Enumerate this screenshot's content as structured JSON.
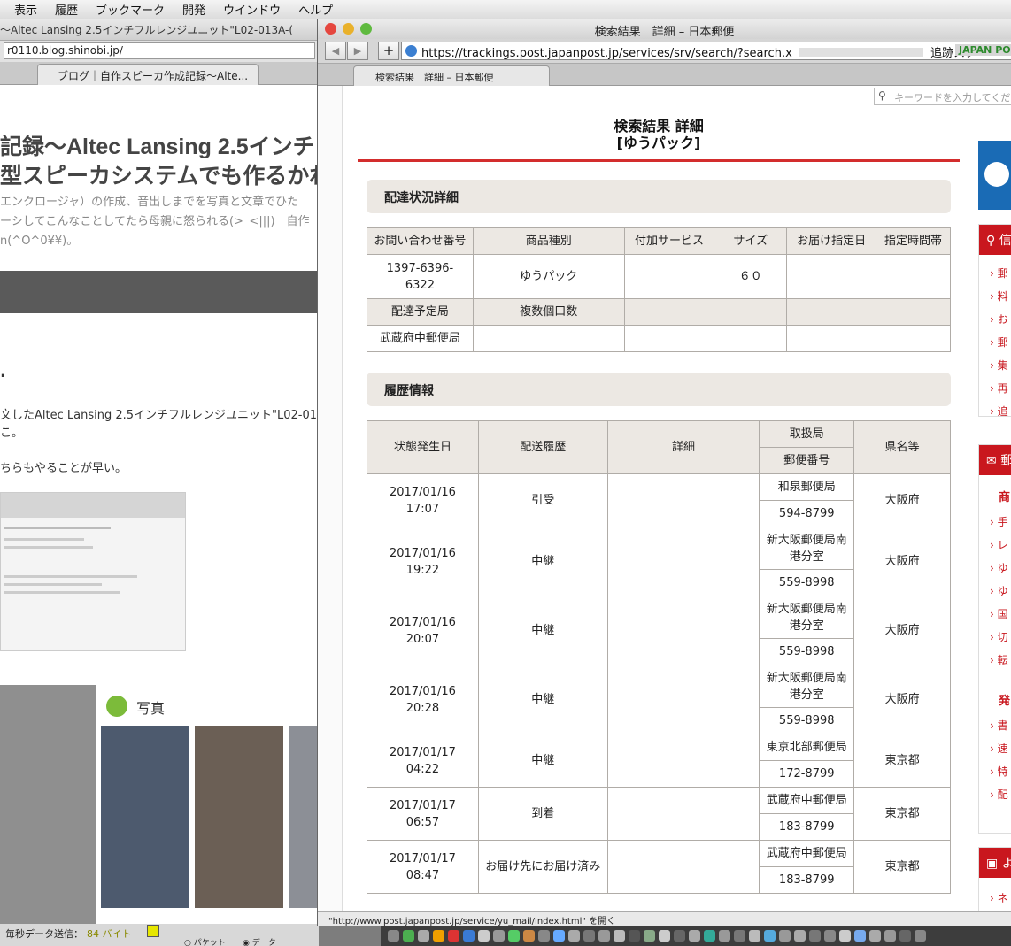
{
  "menubar": [
    "表示",
    "履歴",
    "ブックマーク",
    "開発",
    "ウインドウ",
    "ヘルプ"
  ],
  "bg_window": {
    "title": "〜Altec Lansing 2.5インチフルレンジユニット\"L02-013A-(",
    "url": "r0110.blog.shinobi.jp/",
    "tab": "ブログ｜自作スピーカ作成記録〜Alte...",
    "heading1": "記録〜Altec Lansing 2.5インチフ",
    "heading2": "型スピーカシステムでも作るかね",
    "sub1": "エンクロージャ）の作成、音出しまでを写真と文章でひた",
    "sub2": "ーシしてこんなことしてたら母親に怒られる(>_<|||)　自作",
    "sub3": "n(^O^0¥¥)。",
    "dot": ".",
    "body1": "文したAltec Lansing 2.5インチフルレンジユニット\"L02-01",
    "body2": "こ。",
    "body3": "ちらもやることが早い。",
    "photos_label": "写真",
    "status_label": "毎秒データ送信：",
    "status_value": "84 バイト",
    "radio1": "パケット",
    "radio2": "データ"
  },
  "main_window": {
    "title": "検索結果　詳細 – 日本郵便",
    "url": "https://trackings.post.japanpost.jp/services/srv/search/?search.x",
    "url_suffix": "追跡スター",
    "brand": "JAPAN POST",
    "tab": "検索結果　詳細 – 日本郵便",
    "search_placeholder": "キーワードを入力してくだ",
    "status_text": "\"http://www.post.japanpost.jp/service/yu_mail/index.html\" を開く"
  },
  "page": {
    "title_line1": "検索結果 詳細",
    "title_line2": "[ゆうパック]",
    "section1": "配達状況詳細",
    "section2": "履歴情報"
  },
  "status_table": {
    "headers": [
      "お問い合わせ番号",
      "商品種別",
      "付加サービス",
      "サイズ",
      "お届け指定日",
      "指定時間帯"
    ],
    "tracking_no_1": "1397-6396-",
    "tracking_no_2": "6322",
    "product": "ゆうパック",
    "size": "６０",
    "headers2": [
      "配達予定局",
      "複数個口数"
    ],
    "office": "武蔵府中郵便局"
  },
  "history_table": {
    "headers": [
      "状態発生日",
      "配送履歴",
      "詳細",
      "取扱局",
      "郵便番号",
      "県名等"
    ],
    "rows": [
      {
        "date": "2017/01/16",
        "time": "17:07",
        "event": "引受",
        "office1": "和泉郵便局",
        "office2": "",
        "postal": "594-8799",
        "pref": "大阪府"
      },
      {
        "date": "2017/01/16",
        "time": "19:22",
        "event": "中継",
        "office1": "新大阪郵便局南",
        "office2": "港分室",
        "postal": "559-8998",
        "pref": "大阪府"
      },
      {
        "date": "2017/01/16",
        "time": "20:07",
        "event": "中継",
        "office1": "新大阪郵便局南",
        "office2": "港分室",
        "postal": "559-8998",
        "pref": "大阪府"
      },
      {
        "date": "2017/01/16",
        "time": "20:28",
        "event": "中継",
        "office1": "新大阪郵便局南",
        "office2": "港分室",
        "postal": "559-8998",
        "pref": "大阪府"
      },
      {
        "date": "2017/01/17",
        "time": "04:22",
        "event": "中継",
        "office1": "東京北部郵便局",
        "office2": "",
        "postal": "172-8799",
        "pref": "東京都"
      },
      {
        "date": "2017/01/17",
        "time": "06:57",
        "event": "到着",
        "office1": "武蔵府中郵便局",
        "office2": "",
        "postal": "183-8799",
        "pref": "東京都"
      },
      {
        "date": "2017/01/17",
        "time": "08:47",
        "event": "お届け先にお届け済み",
        "office1": "武蔵府中郵便局",
        "office2": "",
        "postal": "183-8799",
        "pref": "東京都"
      }
    ]
  },
  "sidebar": {
    "red_tab_1": "信",
    "red_tab_2": "郵",
    "red_tab_3": "よ",
    "links_a": [
      "郵",
      "料",
      "お",
      "郵",
      "集",
      "再",
      "追"
    ],
    "sub_a": "商",
    "links_b": [
      "手",
      "レ",
      "ゆ",
      "ゆ",
      "国",
      "切",
      "転"
    ],
    "sub_b": "発",
    "links_c": [
      "書",
      "速",
      "特",
      "配"
    ],
    "links_d": [
      "ネ"
    ]
  },
  "colors": {
    "accent_red": "#c9171e",
    "header_bg": "#ece8e3",
    "blue": "#1a6bb5"
  }
}
